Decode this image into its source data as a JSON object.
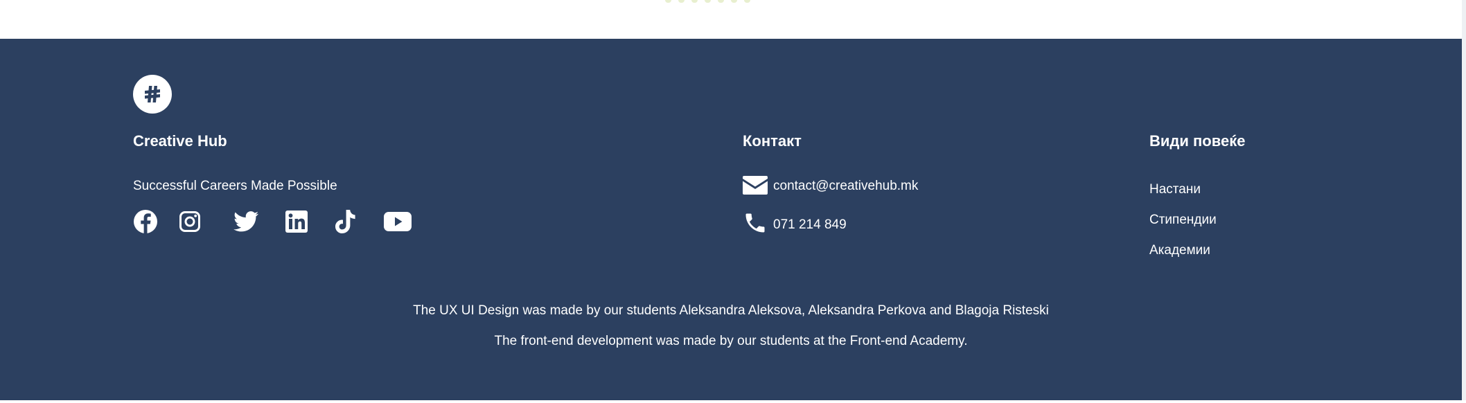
{
  "brand": {
    "name": "Creative Hub",
    "tagline": "Successful Careers Made Possible",
    "logo_icon": "hub-logo-icon"
  },
  "social": [
    {
      "name": "facebook",
      "icon": "facebook-icon"
    },
    {
      "name": "instagram",
      "icon": "instagram-icon"
    },
    {
      "name": "twitter",
      "icon": "twitter-icon"
    },
    {
      "name": "linkedin",
      "icon": "linkedin-icon"
    },
    {
      "name": "tiktok",
      "icon": "tiktok-icon"
    },
    {
      "name": "youtube",
      "icon": "youtube-icon"
    }
  ],
  "contact": {
    "heading": "Контакт",
    "email": "contact@creativehub.mk",
    "phone": "071 214 849"
  },
  "more": {
    "heading": "Види повеќе",
    "links": [
      "Настани",
      "Стипендии",
      "Академии"
    ]
  },
  "credits": {
    "line1": "The UX UI Design was made by our students Aleksandra Aleksova, Aleksandra Perkova and Blagoja Risteski",
    "line2": "The front-end development was made by our students at the Front-end Academy."
  },
  "colors": {
    "footer_background": "#2c4060",
    "text": "#ffffff"
  }
}
